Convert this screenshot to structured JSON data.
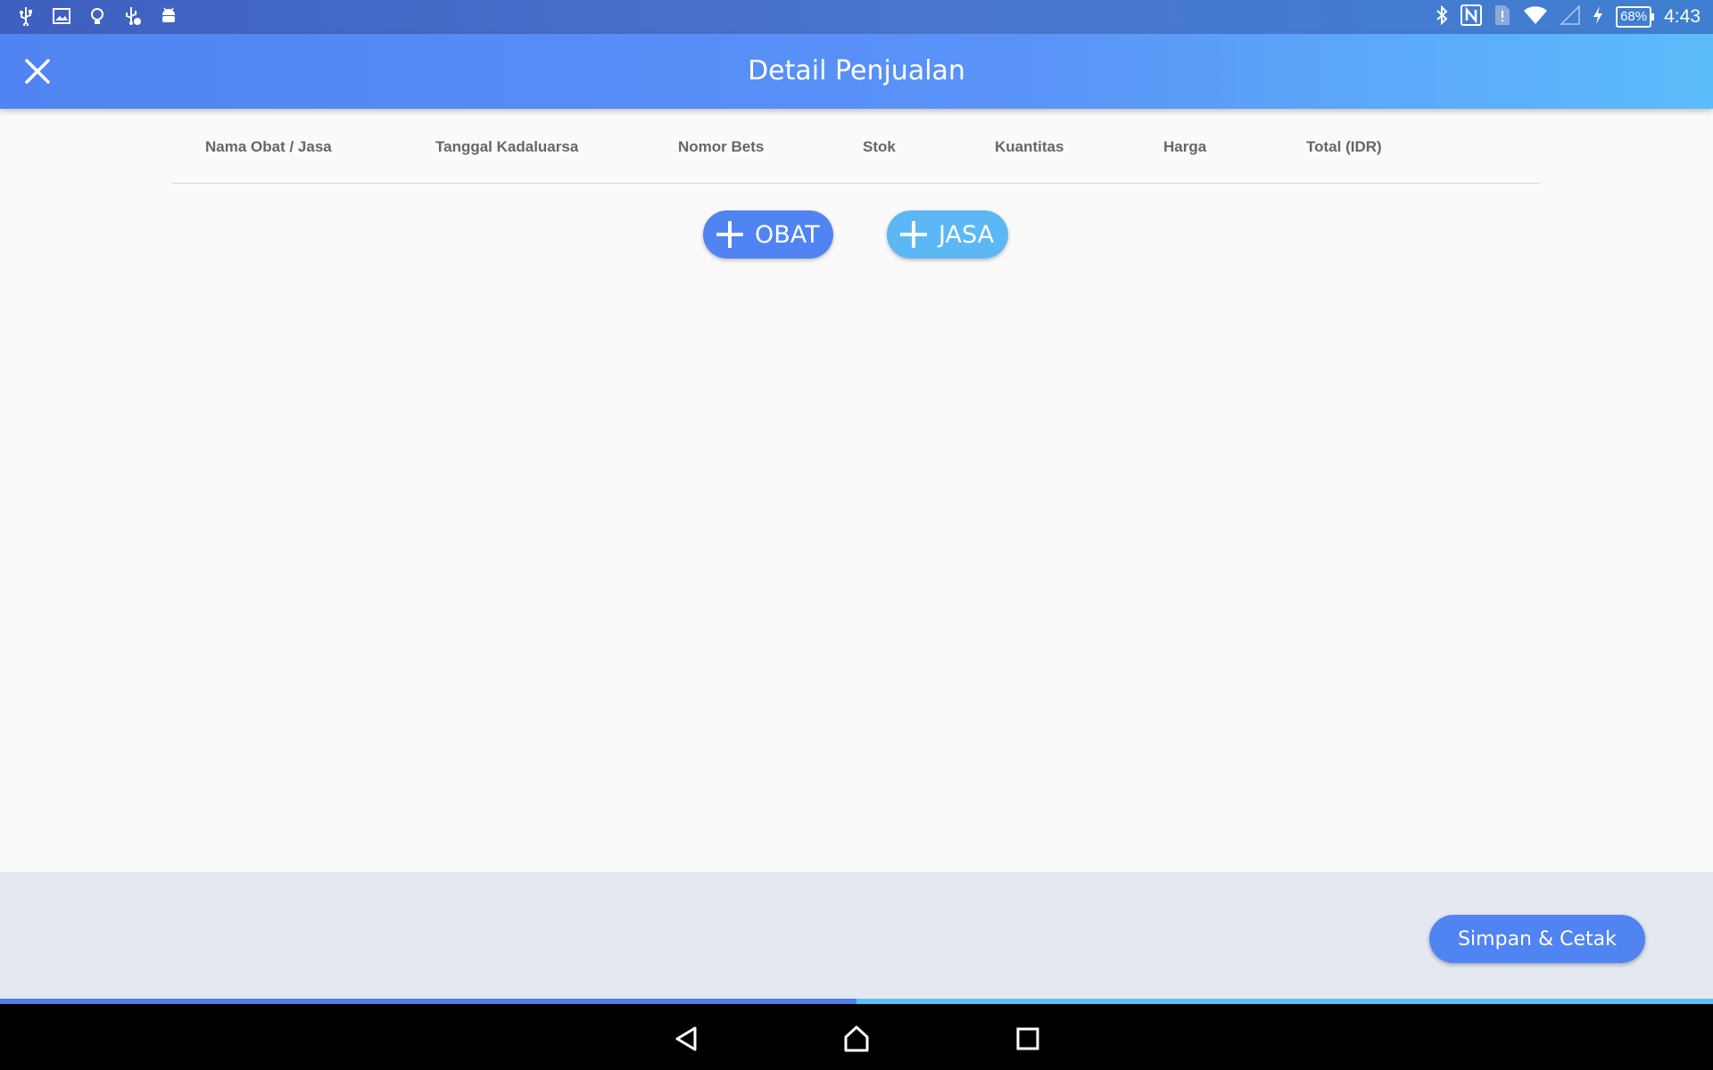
{
  "status_bar": {
    "time": "4:43",
    "battery": "68%",
    "left_icons": [
      "usb-icon",
      "image-icon",
      "lightbulb-icon",
      "usb-debug-icon",
      "android-icon"
    ],
    "right_icons": [
      "bluetooth-icon",
      "nfc-icon",
      "sim-alert-icon",
      "wifi-icon",
      "signal-icon",
      "charging-icon"
    ]
  },
  "app_bar": {
    "title": "Detail Penjualan"
  },
  "table": {
    "columns": [
      "Nama Obat / Jasa",
      "Tanggal Kadaluarsa",
      "Nomor Bets",
      "Stok",
      "Kuantitas",
      "Harga",
      "Total (IDR)"
    ]
  },
  "actions": {
    "obat_label": "OBAT",
    "jasa_label": "JASA"
  },
  "footer": {
    "save_print_label": "Simpan & Cetak"
  },
  "progress": {
    "value": 0.5
  },
  "colors": {
    "primary": "#5084f2",
    "secondary": "#5cb8f5",
    "footer_bg": "#e3e8f1"
  }
}
